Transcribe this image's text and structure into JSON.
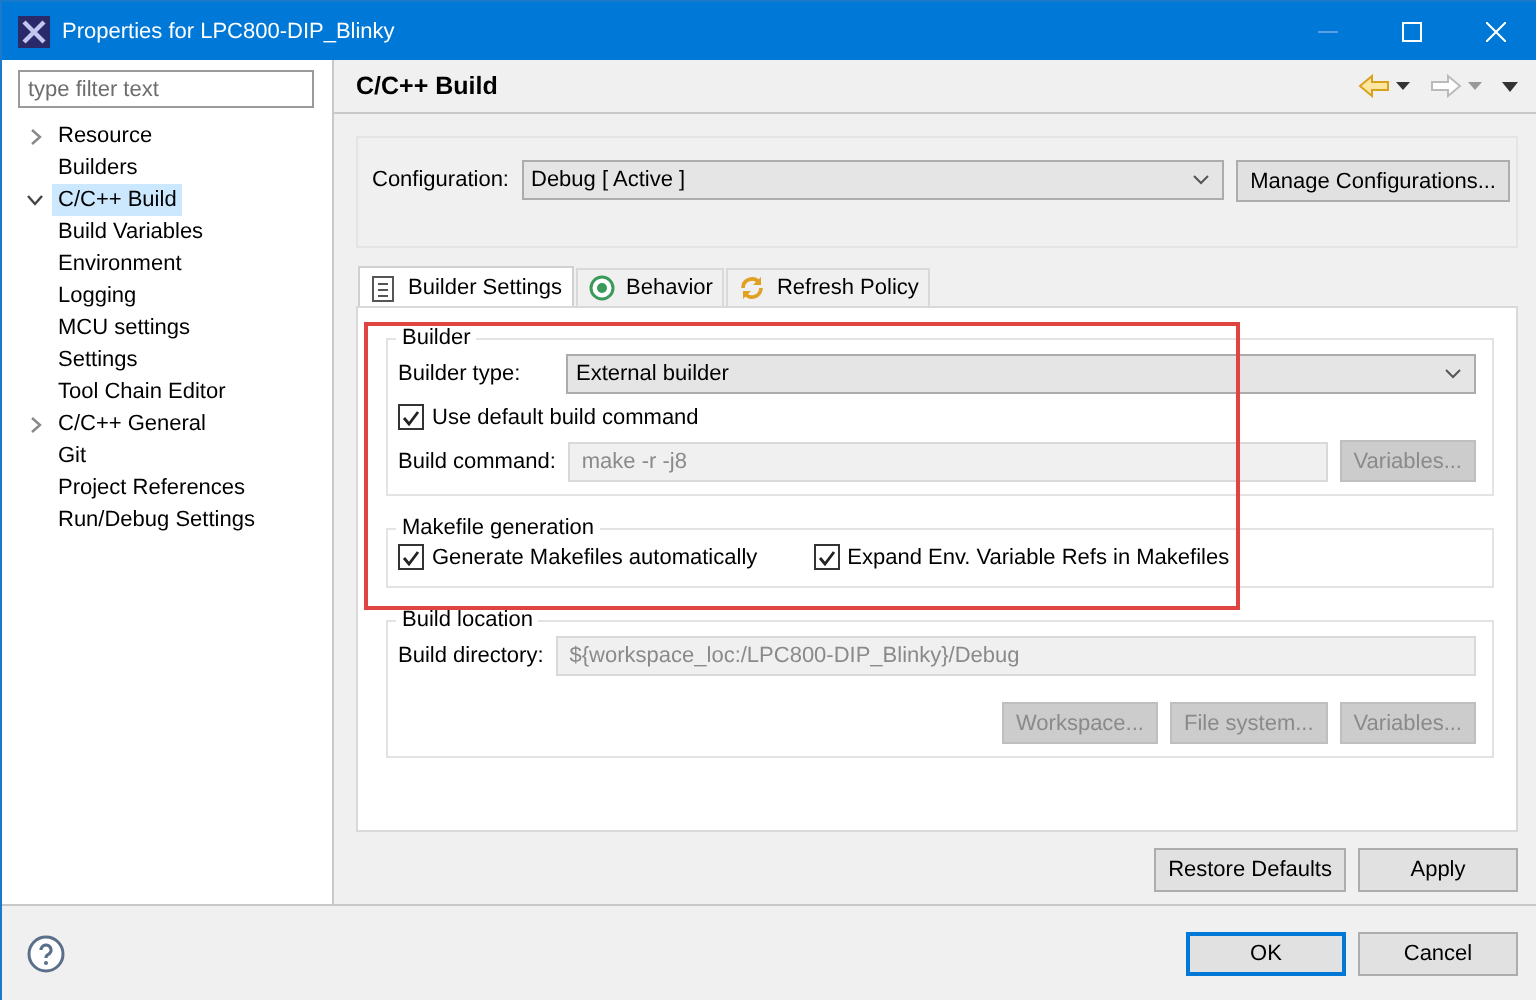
{
  "window": {
    "title": "Properties for LPC800-DIP_Blinky"
  },
  "sidebar": {
    "filter": {
      "placeholder": "type filter text"
    },
    "items": [
      {
        "label": "Resource",
        "expanded": false,
        "selected": false
      },
      {
        "label": "Builders",
        "selected": false
      },
      {
        "label": "C/C++ Build",
        "expanded": true,
        "selected": true,
        "children": [
          {
            "label": "Build Variables",
            "selected": false
          },
          {
            "label": "Environment",
            "selected": false
          },
          {
            "label": "Logging",
            "selected": false
          },
          {
            "label": "MCU settings",
            "selected": false
          },
          {
            "label": "Settings",
            "selected": false
          },
          {
            "label": "Tool Chain Editor",
            "selected": false
          }
        ]
      },
      {
        "label": "C/C++ General",
        "expanded": false,
        "selected": false
      },
      {
        "label": "Git",
        "selected": false
      },
      {
        "label": "Project References",
        "selected": false
      },
      {
        "label": "Run/Debug Settings",
        "selected": false
      }
    ]
  },
  "page": {
    "title": "C/C++ Build",
    "configuration": {
      "label": "Configuration:",
      "value": "Debug  [ Active ]",
      "button": "Manage Configurations..."
    },
    "tabs": [
      {
        "label": "Builder Settings",
        "selected": true
      },
      {
        "label": "Behavior",
        "selected": false
      },
      {
        "label": "Refresh Policy",
        "selected": false
      }
    ],
    "builder": {
      "title": "Builder",
      "type_label": "Builder type:",
      "type_value": "External builder",
      "use_default": {
        "label": "Use default build command",
        "checked": true
      },
      "command_label": "Build command:",
      "command_value": "make -r -j8",
      "command_disabled": true,
      "variables": {
        "label": "Variables...",
        "disabled": true
      }
    },
    "makefile": {
      "title": "Makefile generation",
      "options": [
        {
          "label": "Generate Makefiles automatically",
          "checked": true
        },
        {
          "label": "Expand Env. Variable Refs in Makefiles",
          "checked": true
        }
      ]
    },
    "location": {
      "title": "Build location",
      "directory_label": "Build directory:",
      "directory_value": "${workspace_loc:/LPC800-DIP_Blinky}/Debug",
      "directory_disabled": true,
      "buttons": [
        {
          "label": "Workspace...",
          "disabled": true
        },
        {
          "label": "File system...",
          "disabled": true
        },
        {
          "label": "Variables...",
          "disabled": true
        }
      ]
    },
    "highlight": true,
    "buttons": [
      "Restore Defaults",
      "Apply"
    ]
  },
  "footer": {
    "buttons": [
      {
        "label": "OK",
        "default": true
      },
      {
        "label": "Cancel",
        "default": false
      }
    ]
  }
}
